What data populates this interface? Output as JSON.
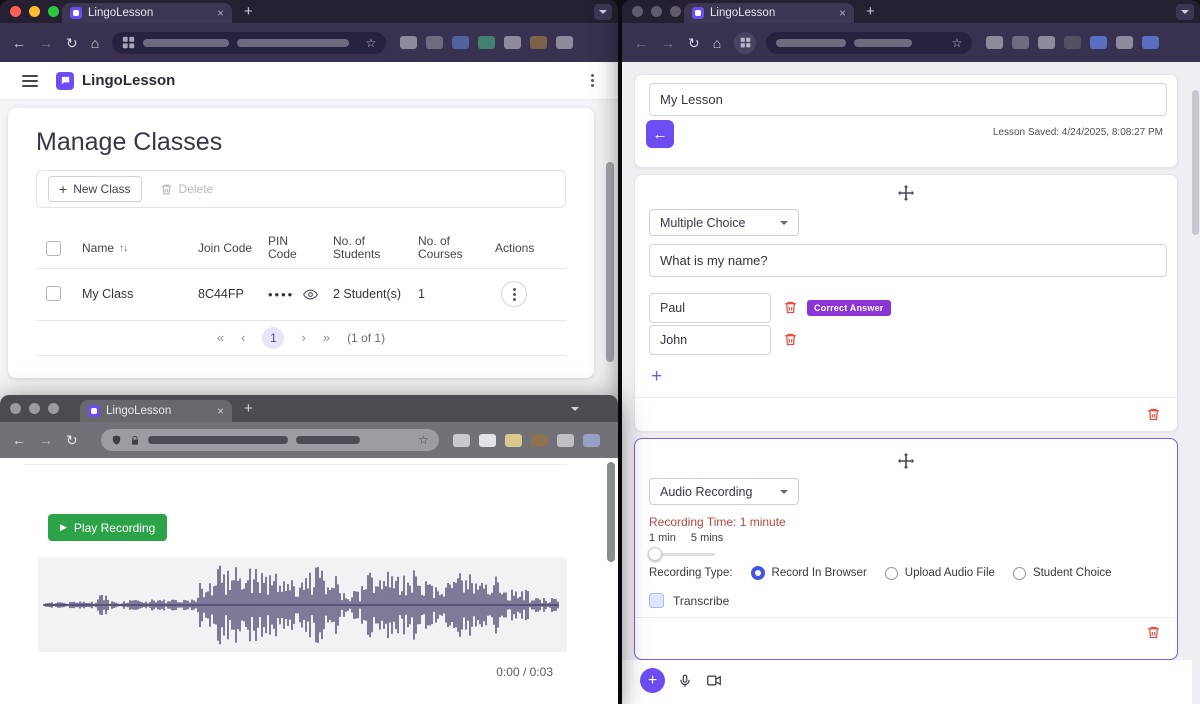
{
  "colors": {
    "accent_purple": "#6d4df2",
    "badge_purple": "#8b35d6",
    "danger_red": "#e04f44",
    "success_green": "#2ca348",
    "radio_blue": "#4356e0",
    "waveform_purple": "#4b4870",
    "warn_red": "#b5483f"
  },
  "chrome": {
    "back_icon": "←",
    "forward_icon": "→",
    "reload_icon": "↻",
    "home_icon": "⌂",
    "star_icon": "☆",
    "new_tab_icon": "+",
    "close_icon": "×"
  },
  "left_window": {
    "tab_title": "LingoLesson",
    "app_name": "LingoLesson",
    "page_title": "Manage Classes",
    "toolbar": {
      "plus_icon": "+",
      "new_class_label": "New Class",
      "delete_label": "Delete"
    },
    "table": {
      "headers": {
        "name": "Name",
        "join_code": "Join Code",
        "pin_code": "PIN Code",
        "students": "No. of Students",
        "courses": "No. of Courses",
        "actions": "Actions"
      },
      "row": {
        "name": "My Class",
        "join_code": "8C44FP",
        "pin_masked": "••••",
        "students": "2 Student(s)",
        "courses": "1"
      }
    },
    "pagination": {
      "first": "«",
      "prev": "‹",
      "current": "1",
      "next": "›",
      "last": "»",
      "summary": "(1 of 1)"
    }
  },
  "bottom_window": {
    "tab_title": "LingoLesson",
    "play_icon": "▶",
    "play_button_label": "Play Recording",
    "time_display": "0:00 / 0:03"
  },
  "right_window": {
    "tab_title": "LingoLesson",
    "add_element_icon": "+",
    "header": {
      "back_icon": "←",
      "lesson_title_value": "My Lesson",
      "saved_status": "Lesson Saved: 4/24/2025, 8:08:27 PM"
    },
    "question_card": {
      "type_selected": "Multiple Choice",
      "question_value": "What is my name?",
      "answer1_value": "Paul",
      "answer2_value": "John",
      "correct_badge": "Correct Answer",
      "add_answer_icon": "+"
    },
    "audio_card": {
      "type_selected": "Audio Recording",
      "recording_time_text": "Recording Time: 1 minute",
      "slider_min_label": "1 min",
      "slider_max_label": "5 mins",
      "recording_type_label": "Recording Type:",
      "option1": "Record In Browser",
      "option2": "Upload Audio File",
      "option3": "Student Choice",
      "selected_option": "Record In Browser",
      "transcribe_label": "Transcribe"
    }
  }
}
